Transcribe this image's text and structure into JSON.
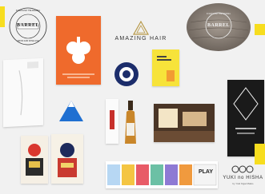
{
  "barrel_logo": {
    "ring_top": "IN AROUND THE BARREL",
    "name": "BARREL",
    "ring_bottom": "DRINK AND WINE LIFE"
  },
  "amazing_hair": {
    "label": "AMAZING HAIR"
  },
  "wood_plate_logo": {
    "ring_top": "IN AROUND THE BARREL",
    "name": "BARREL"
  },
  "yuki_no_hisha": {
    "label": "YUKI no HISHA",
    "sub": "by Yuki Kigai Maiko"
  },
  "play_poster": {
    "label": "PLAY"
  },
  "colors": {
    "orange": "#ef6a2c",
    "yellow": "#f7dd1f",
    "gold": "#b89a4a",
    "blue": "#1f6fd1",
    "navy": "#1c2d6b"
  }
}
